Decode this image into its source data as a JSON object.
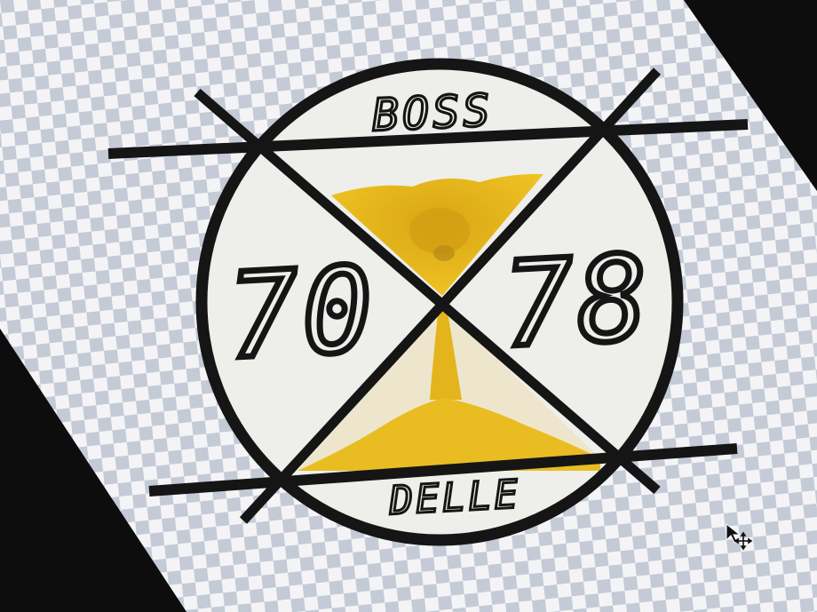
{
  "logo": {
    "top_text": "BOSS",
    "left_number": "70",
    "right_number": "78",
    "bottom_text": "DELLE"
  },
  "colors": {
    "ring": "#151515",
    "disc": "#eeeeea",
    "sand": "#e8bb1c",
    "sand_dark": "#c99a10",
    "checker_light": "#f4f4f6",
    "checker_dark": "#c4cbd6",
    "bezel": "#0d0d0d"
  },
  "cursor": {
    "icon": "move-cursor-icon"
  }
}
